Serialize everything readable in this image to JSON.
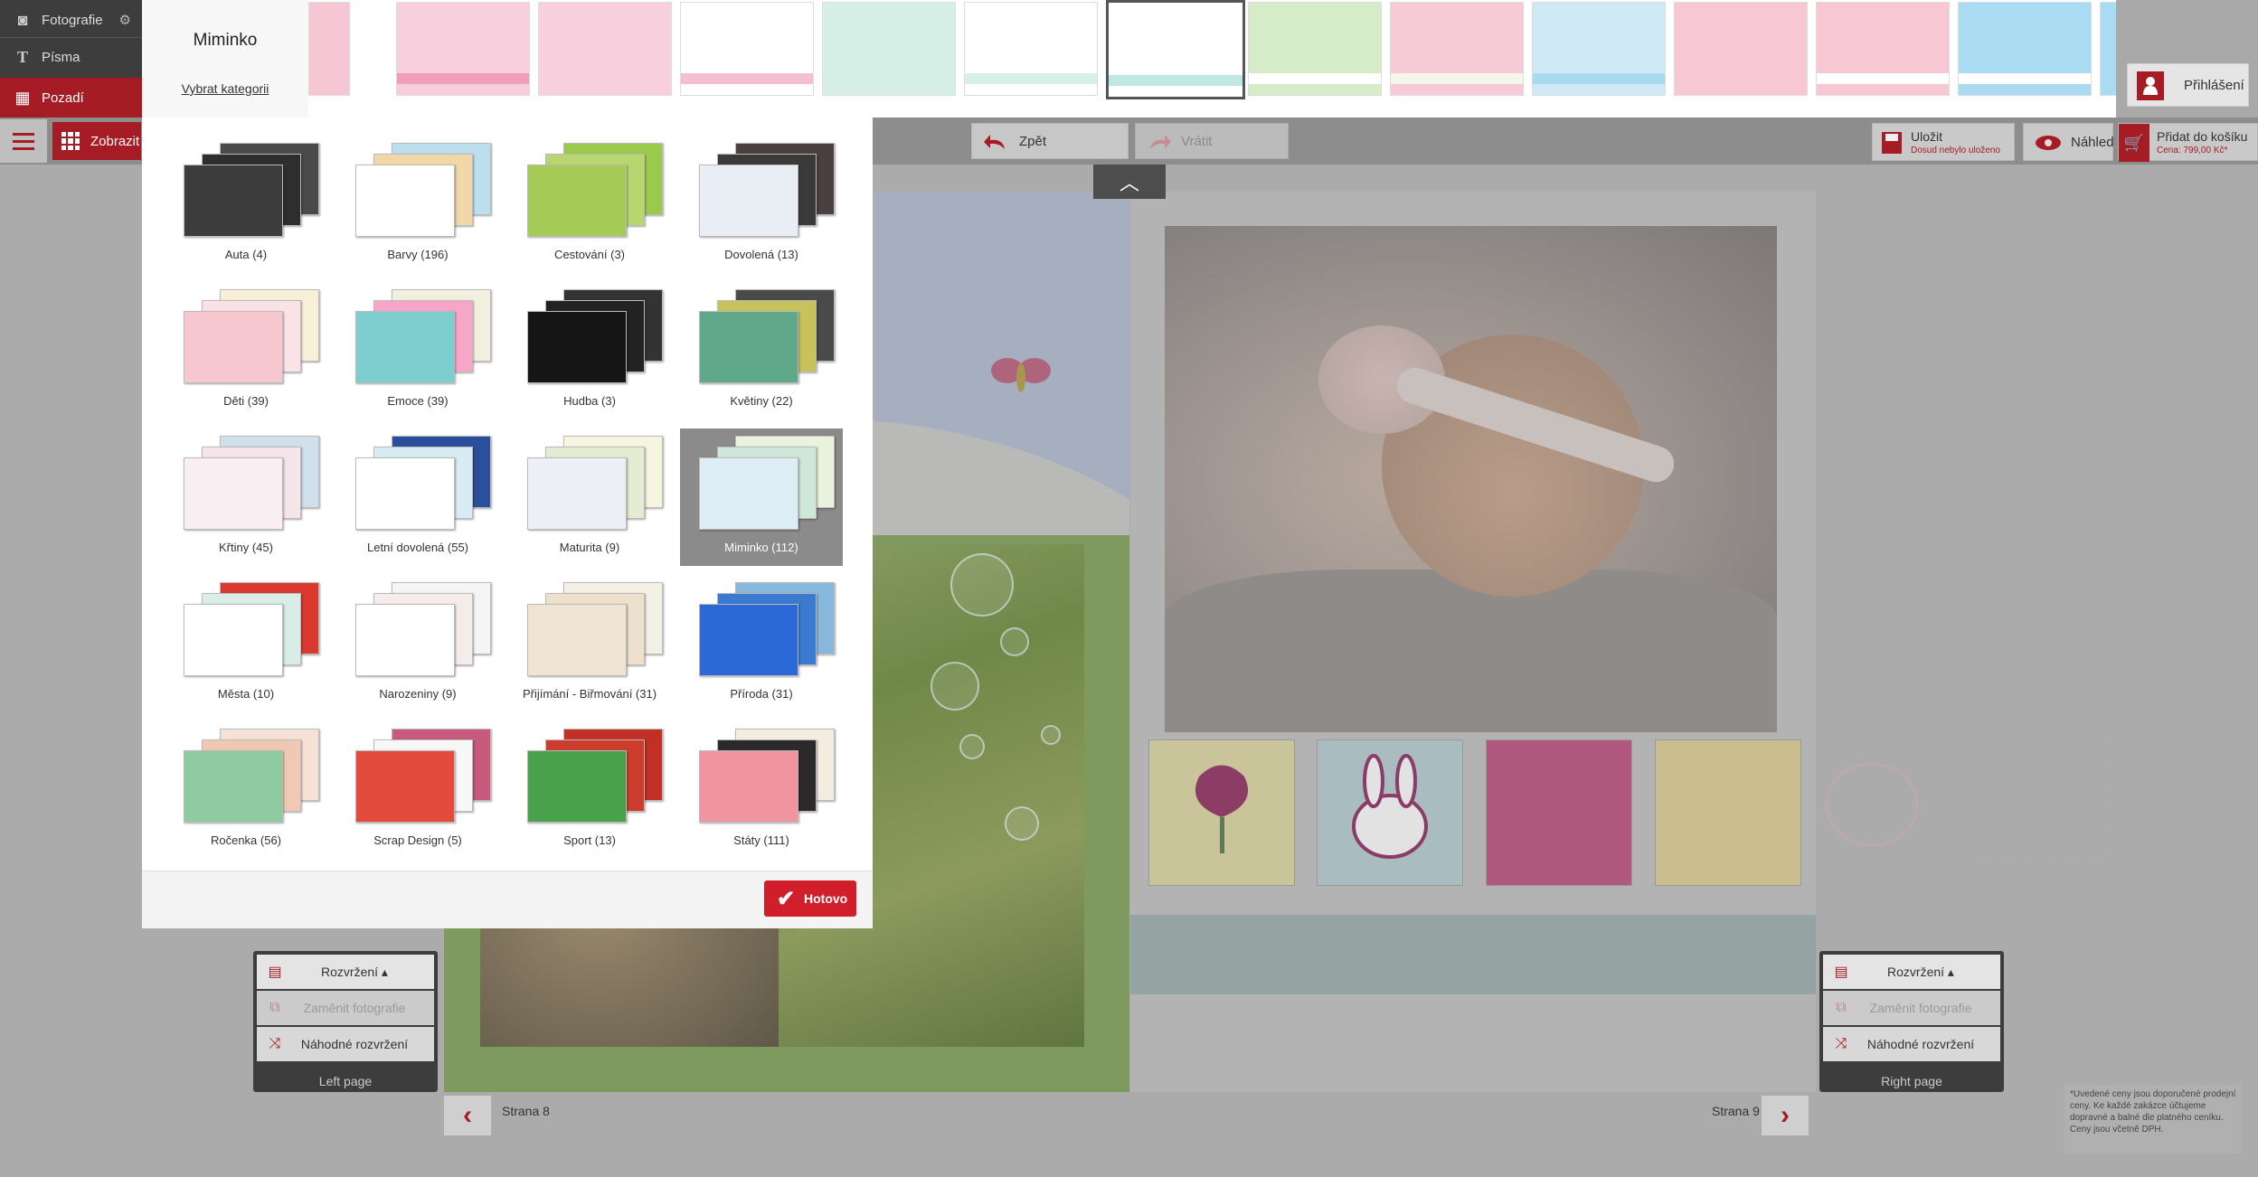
{
  "tools": [
    {
      "label": "Fotografie",
      "icon": "camera-icon",
      "active": false
    },
    {
      "label": "Písma",
      "icon": "text-icon",
      "active": false
    },
    {
      "label": "Pozadí",
      "icon": "background-icon",
      "active": true
    }
  ],
  "category_header": {
    "title": "Miminko",
    "link": "Vybrat kategorii"
  },
  "toolbar": {
    "show_label": "Zobrazit",
    "undo_label": "Zpět",
    "redo_label": "Vrátit",
    "save_label": "Uložit",
    "save_status": "Dosud nebylo uloženo",
    "preview_label": "Náhled",
    "cart_label": "Přidat do košíku",
    "cart_price": "Cena: 799,00 Kč*",
    "login_label": "Přihlášení"
  },
  "categories": [
    {
      "label": "Auta (4)",
      "colors": [
        "#3c3c3c",
        "#2e2e2e",
        "#4a4a4a"
      ],
      "selected": false
    },
    {
      "label": "Barvy (196)",
      "colors": [
        "#ffffff",
        "#f2d7a8",
        "#bcdff0"
      ],
      "selected": false
    },
    {
      "label": "Cestování (3)",
      "colors": [
        "#a6cc57",
        "#b8d66e",
        "#9bc94b"
      ],
      "selected": false
    },
    {
      "label": "Dovolená (13)",
      "colors": [
        "#e8eef4",
        "#3a3a3a",
        "#4a4040"
      ],
      "selected": false
    },
    {
      "label": "Děti (39)",
      "colors": [
        "#f7c7cf",
        "#fbe2e6",
        "#f8f0d8"
      ],
      "selected": false
    },
    {
      "label": "Emoce (39)",
      "colors": [
        "#7dcfcf",
        "#f7a6c9",
        "#f1f0e0"
      ],
      "selected": false
    },
    {
      "label": "Hudba (3)",
      "colors": [
        "#151515",
        "#222222",
        "#333333"
      ],
      "selected": false
    },
    {
      "label": "Květiny (22)",
      "colors": [
        "#5fa889",
        "#c8c25a",
        "#4a4a4a"
      ],
      "selected": false
    },
    {
      "label": "Křtiny (45)",
      "colors": [
        "#f9eef1",
        "#f5e4e8",
        "#cfe0ec"
      ],
      "selected": false
    },
    {
      "label": "Letní dovolená (55)",
      "colors": [
        "#ffffff",
        "#d8ecf3",
        "#2a4f9c"
      ],
      "selected": false
    },
    {
      "label": "Maturita (9)",
      "colors": [
        "#eeeef7",
        "#e4ecd3",
        "#f7f4df"
      ],
      "selected": false
    },
    {
      "label": "Miminko (112)",
      "colors": [
        "#dcedf6",
        "#cfe7d8",
        "#e8f2dc"
      ],
      "selected": true
    },
    {
      "label": "Města (10)",
      "colors": [
        "#ffffff",
        "#d9ece6",
        "#d9392f"
      ],
      "selected": false
    },
    {
      "label": "Narozeniny (9)",
      "colors": [
        "#ffffff",
        "#f3ecea",
        "#f5f5f5"
      ],
      "selected": false
    },
    {
      "label": "Přijímání - Biřmování (31)",
      "colors": [
        "#f0e4d2",
        "#ede1cc",
        "#f5f0e6"
      ],
      "selected": false
    },
    {
      "label": "Příroda (31)",
      "colors": [
        "#2a69d6",
        "#3a7ad0",
        "#87b8db"
      ],
      "selected": false
    },
    {
      "label": "Ročenka (56)",
      "colors": [
        "#8fcba0",
        "#f0c8b3",
        "#f5e2d5"
      ],
      "selected": false
    },
    {
      "label": "Scrap Design (5)",
      "colors": [
        "#e34c3c",
        "#f7f7f7",
        "#c65b7d"
      ],
      "selected": false
    },
    {
      "label": "Sport (13)",
      "colors": [
        "#4aa14c",
        "#cd3d2d",
        "#c42f25"
      ],
      "selected": false
    },
    {
      "label": "Státy (111)",
      "colors": [
        "#f0959f",
        "#2a2a2a",
        "#f2ede0"
      ],
      "selected": false
    }
  ],
  "done_label": "Hotovo",
  "swatches": [
    {
      "bg": "#f7c6d5",
      "accent": "#f7c6d5"
    },
    {
      "bg": "#f7cfdc",
      "accent": "#ef9fbb"
    },
    {
      "bg": "#f8cfdc",
      "accent": "#f8cfdc"
    },
    {
      "bg": "#ffffff",
      "accent": "#f4c0d0"
    },
    {
      "bg": "#d6f0e8",
      "accent": "#d6f0e8"
    },
    {
      "bg": "#ffffff",
      "accent": "#d6f0e8"
    },
    {
      "bg": "#ffffff",
      "accent": "#bfe8e3"
    },
    {
      "bg": "#d6ecc9",
      "accent": "#ffffff"
    },
    {
      "bg": "#f7cad8",
      "accent": "#f5f5e9"
    },
    {
      "bg": "#cfe9f5",
      "accent": "#a9d9ee"
    },
    {
      "bg": "#f7c7d4",
      "accent": "#f7c7d4"
    },
    {
      "bg": "#f7c7d4",
      "accent": "#ffffff"
    },
    {
      "bg": "#a9dcf3",
      "accent": "#ffffff"
    },
    {
      "bg": "#a9dcf3",
      "accent": "#a9dcf3"
    }
  ],
  "left_panel": {
    "menu": "Rozvržení",
    "swap": "Zaměnit fotografie",
    "random": "Náhodné rozvržení",
    "footer": "Left page"
  },
  "right_panel": {
    "menu": "Rozvržení",
    "swap": "Zaměnit fotografie",
    "random": "Náhodné rozvržení",
    "footer": "Right page"
  },
  "pages": {
    "left": "Strana 8",
    "right": "Strana 9"
  },
  "note": "*Uvedené ceny jsou doporučené prodejní ceny. Ke každé zakázce účtujeme dopravné a balné dle platného ceníku. Ceny jsou včetně DPH.",
  "accent": "#a51c24"
}
